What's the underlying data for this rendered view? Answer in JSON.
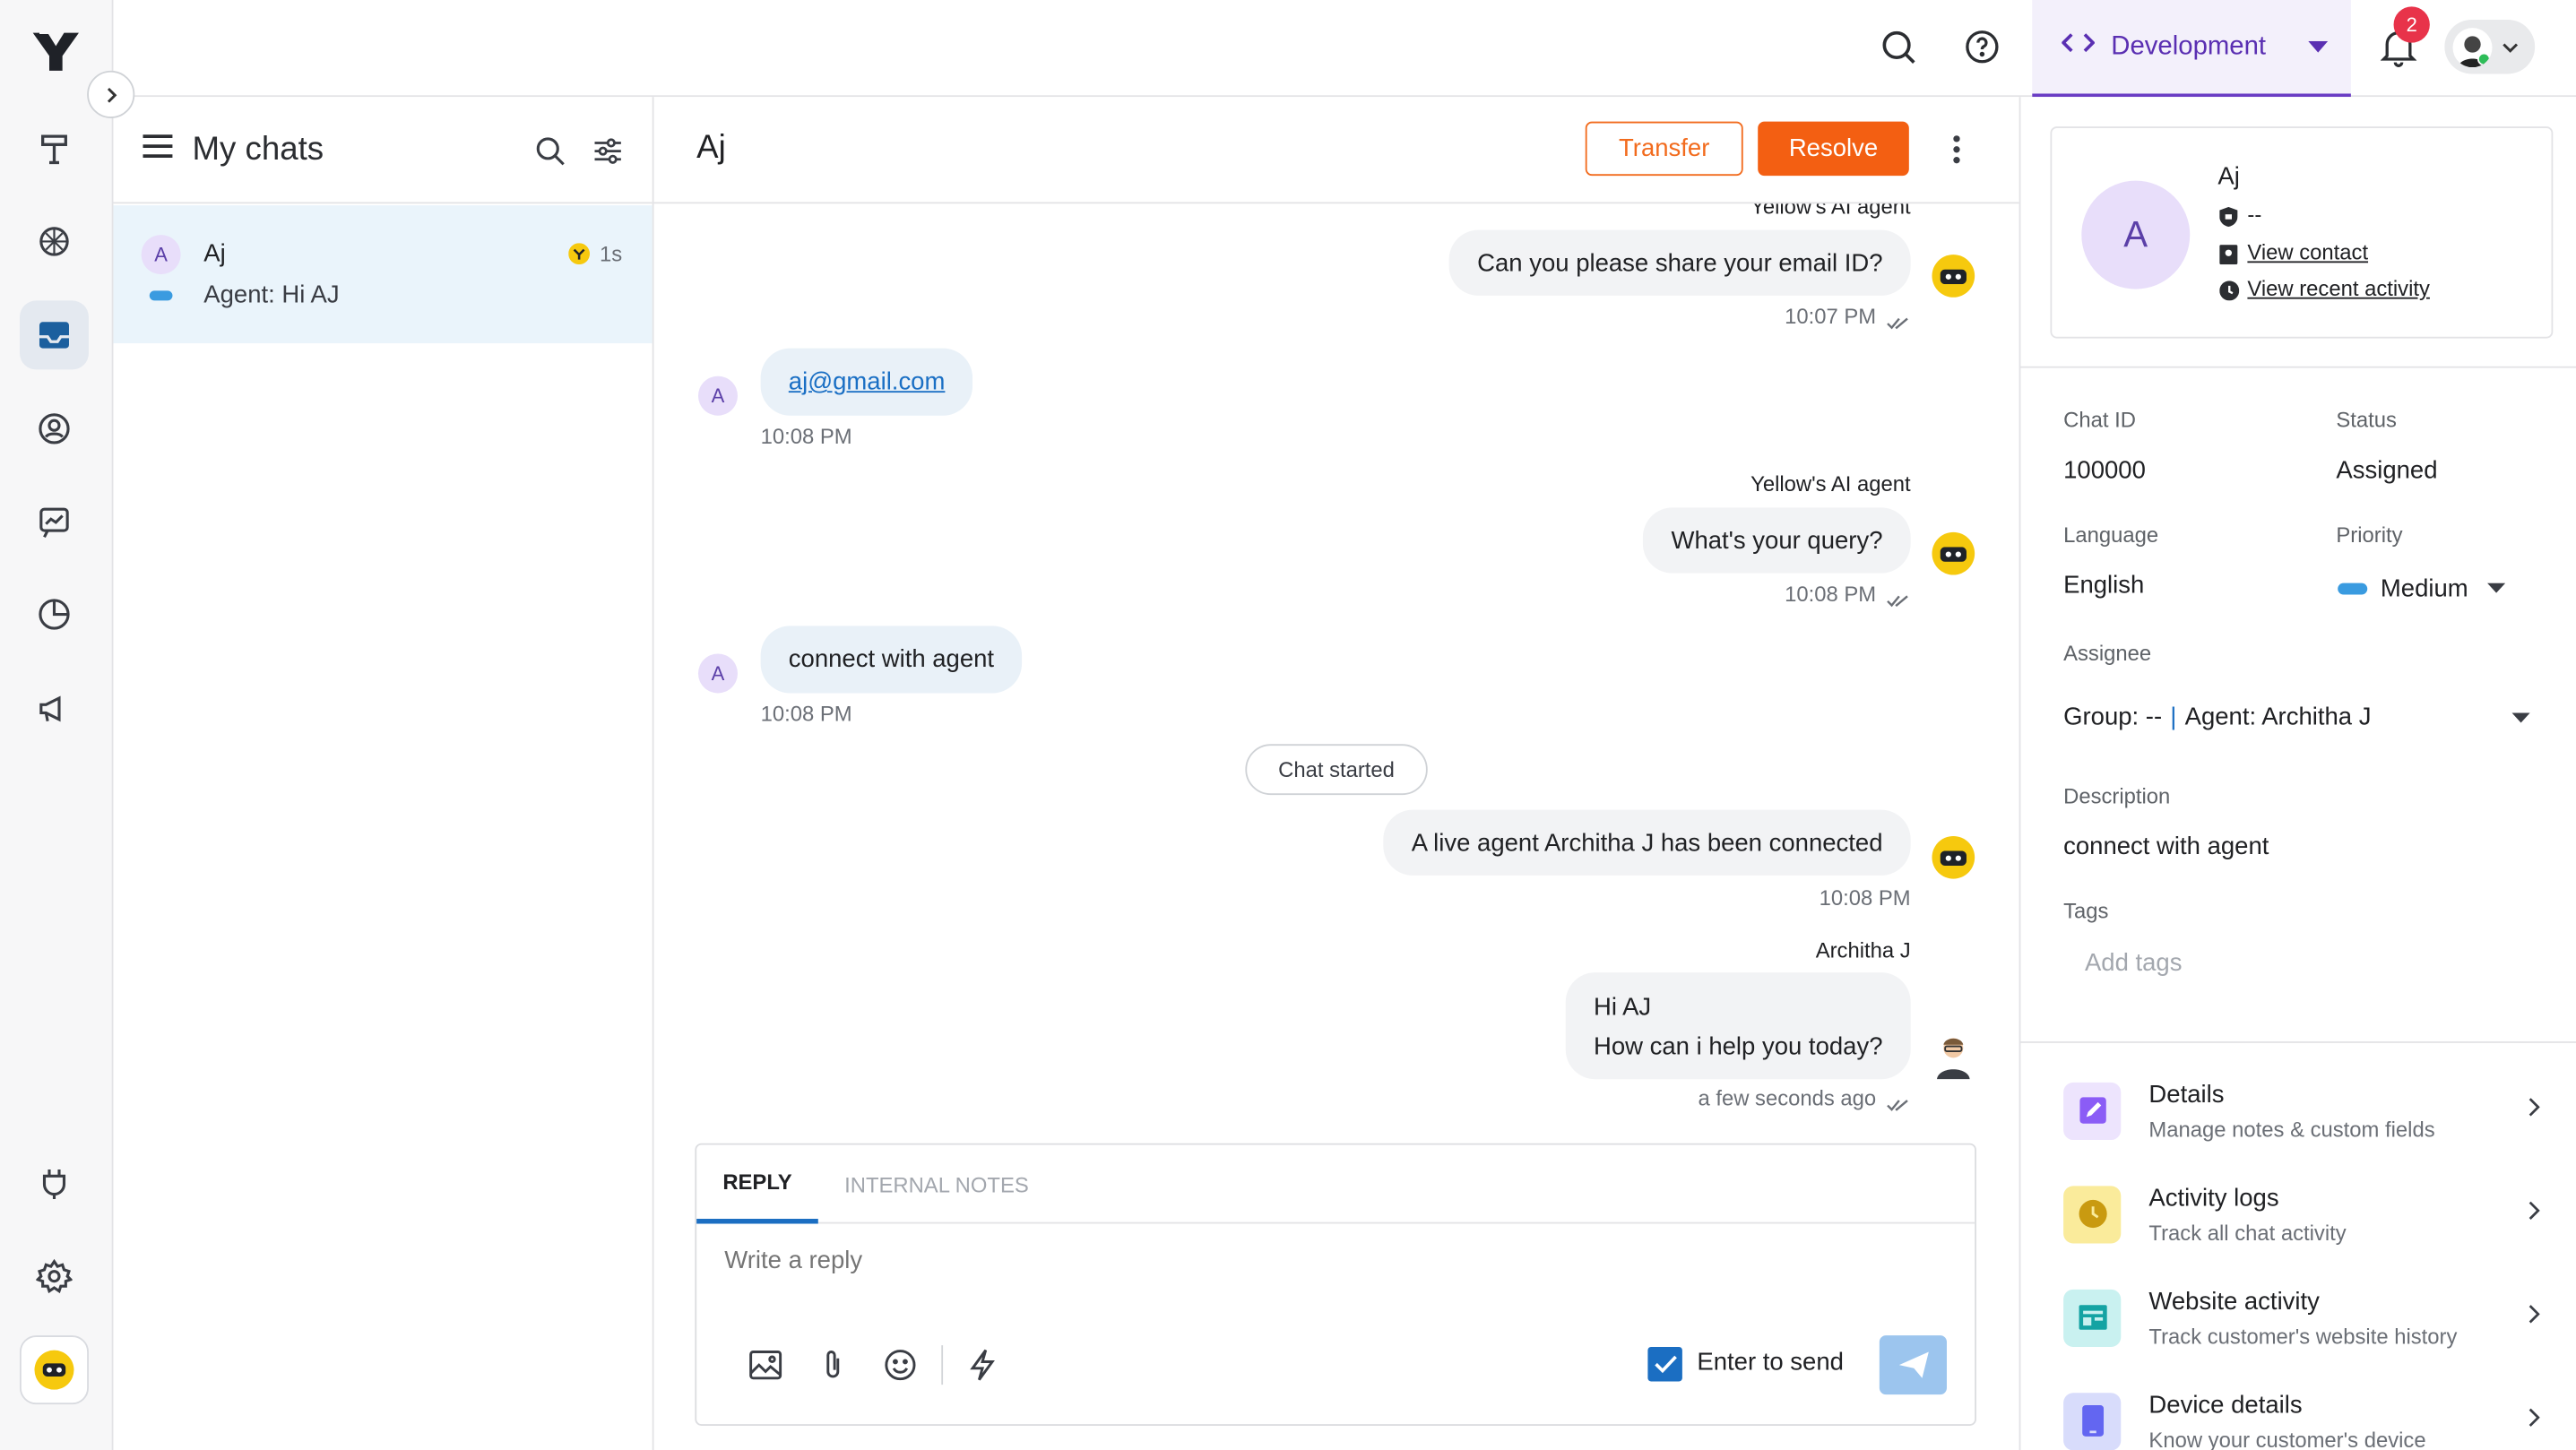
{
  "topbar": {
    "environment": "Development",
    "notifications_count": "2"
  },
  "chat_list": {
    "title": "My chats",
    "items": [
      {
        "initial": "A",
        "name": "Aj",
        "preview": "Agent: Hi AJ",
        "time": "1s"
      }
    ]
  },
  "conversation": {
    "title": "Aj",
    "transfer_label": "Transfer",
    "resolve_label": "Resolve",
    "messages": [
      {
        "sender": "Yellow's AI agent",
        "text": "Can you please share your email ID?",
        "time": "10:07 PM"
      },
      {
        "initial": "A",
        "text": "aj@gmail.com",
        "time": "10:08 PM"
      },
      {
        "sender": "Yellow's AI agent",
        "text": "What's your query?",
        "time": "10:08 PM"
      },
      {
        "initial": "A",
        "text": "connect with agent",
        "time": "10:08 PM"
      },
      {
        "system": "Chat started"
      },
      {
        "text": "A live agent Architha J has been connected",
        "time": "10:08 PM"
      },
      {
        "sender": "Architha J",
        "line1": "Hi AJ",
        "line2": "How can i help you today?",
        "time": "a few seconds ago"
      }
    ],
    "composer": {
      "tab_reply": "REPLY",
      "tab_notes": "INTERNAL NOTES",
      "placeholder": "Write a reply",
      "enter_to_send": "Enter to send",
      "enter_to_send_checked": true
    }
  },
  "contact": {
    "initial": "A",
    "name": "Aj",
    "id_value": "--",
    "view_contact": "View contact",
    "view_activity": "View recent activity"
  },
  "details": {
    "chat_id_label": "Chat ID",
    "chat_id": "100000",
    "status_label": "Status",
    "status": "Assigned",
    "language_label": "Language",
    "language": "English",
    "priority_label": "Priority",
    "priority": "Medium",
    "assignee_label": "Assignee",
    "assignee_group": "Group: --",
    "assignee_sep": "|",
    "assignee_agent": "Agent: Architha J",
    "description_label": "Description",
    "description": "connect with agent",
    "tags_label": "Tags",
    "tags_placeholder": "Add tags"
  },
  "panels": [
    {
      "title": "Details",
      "subtitle": "Manage notes & custom fields",
      "color": "#8b5cf6",
      "icon": "edit-icon"
    },
    {
      "title": "Activity logs",
      "subtitle": "Track all chat activity",
      "color": "#d4a514",
      "icon": "clock-icon"
    },
    {
      "title": "Website activity",
      "subtitle": "Track customer's website history",
      "color": "#14a3a3",
      "icon": "website-icon"
    },
    {
      "title": "Device details",
      "subtitle": "Know your customer's device",
      "color": "#6366f1",
      "icon": "device-icon"
    }
  ]
}
